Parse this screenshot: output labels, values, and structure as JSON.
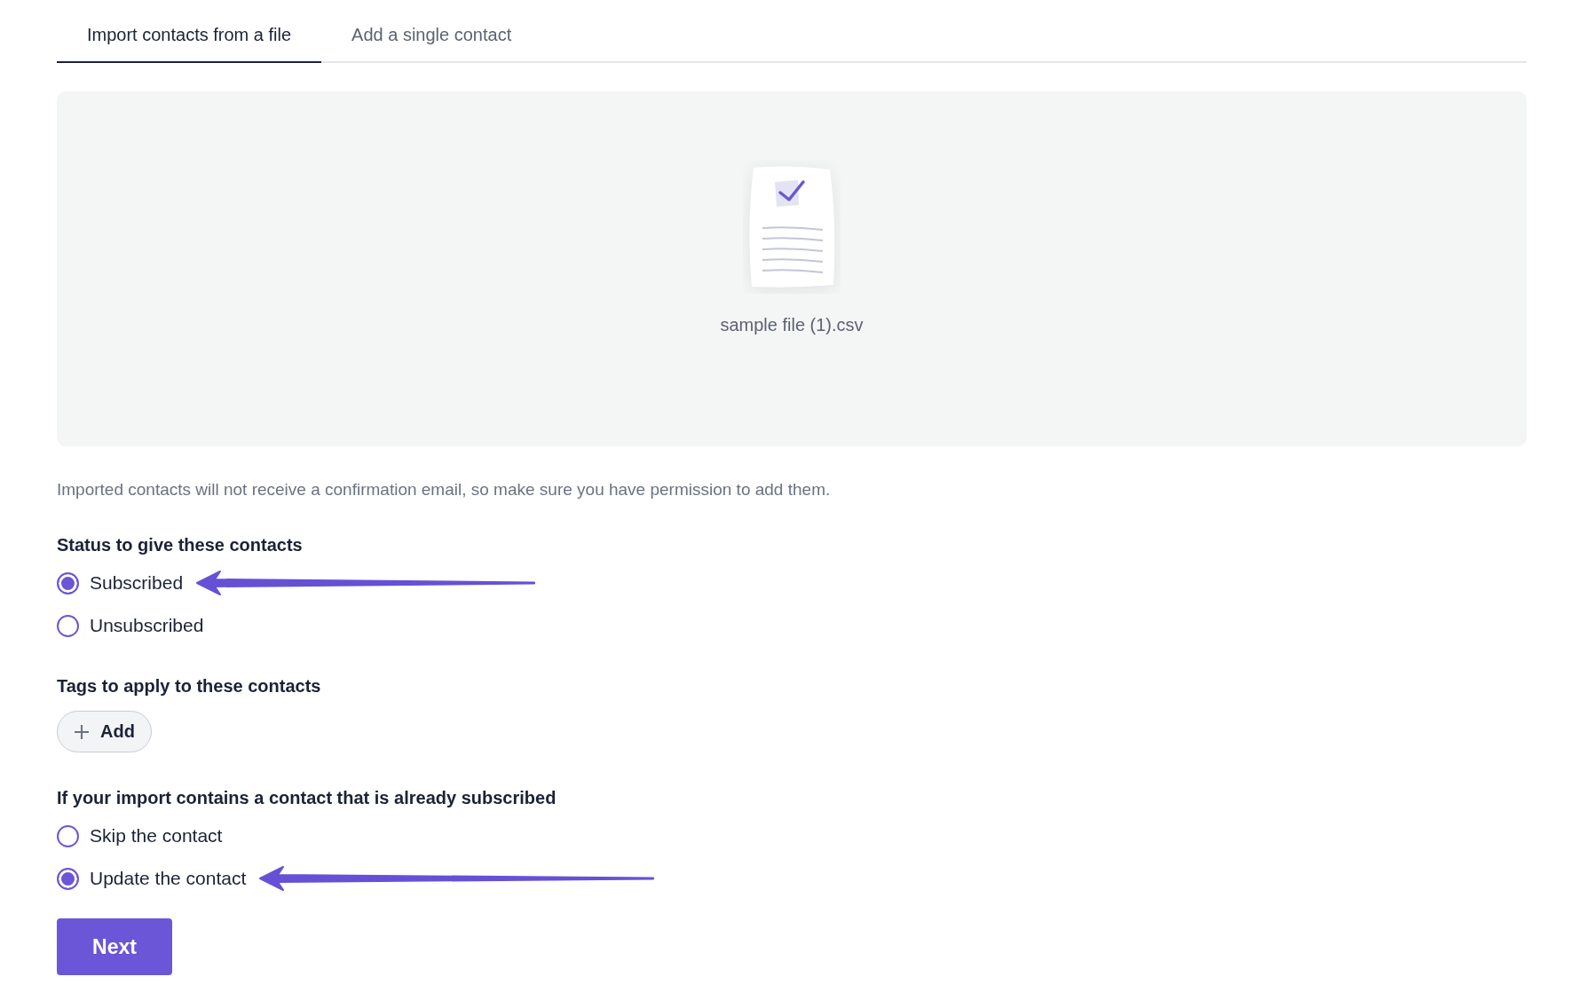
{
  "tabs": [
    {
      "label": "Import contacts from a file",
      "selected": true
    },
    {
      "label": "Add a single contact",
      "selected": false
    }
  ],
  "upload": {
    "file_name": "sample file (1).csv"
  },
  "notice": "Imported contacts will not receive a confirmation email, so make sure you have permission to add them.",
  "status": {
    "heading": "Status to give these contacts",
    "options": [
      {
        "label": "Subscribed",
        "selected": true,
        "arrow": true
      },
      {
        "label": "Unsubscribed",
        "selected": false,
        "arrow": false
      }
    ]
  },
  "tags": {
    "heading": "Tags to apply to these contacts",
    "add_button": "Add"
  },
  "existing": {
    "heading": "If your import contains a contact that is already subscribed",
    "options": [
      {
        "label": "Skip the contact",
        "selected": false,
        "arrow": false
      },
      {
        "label": "Update the contact",
        "selected": true,
        "arrow": true
      }
    ]
  },
  "next_button": "Next"
}
